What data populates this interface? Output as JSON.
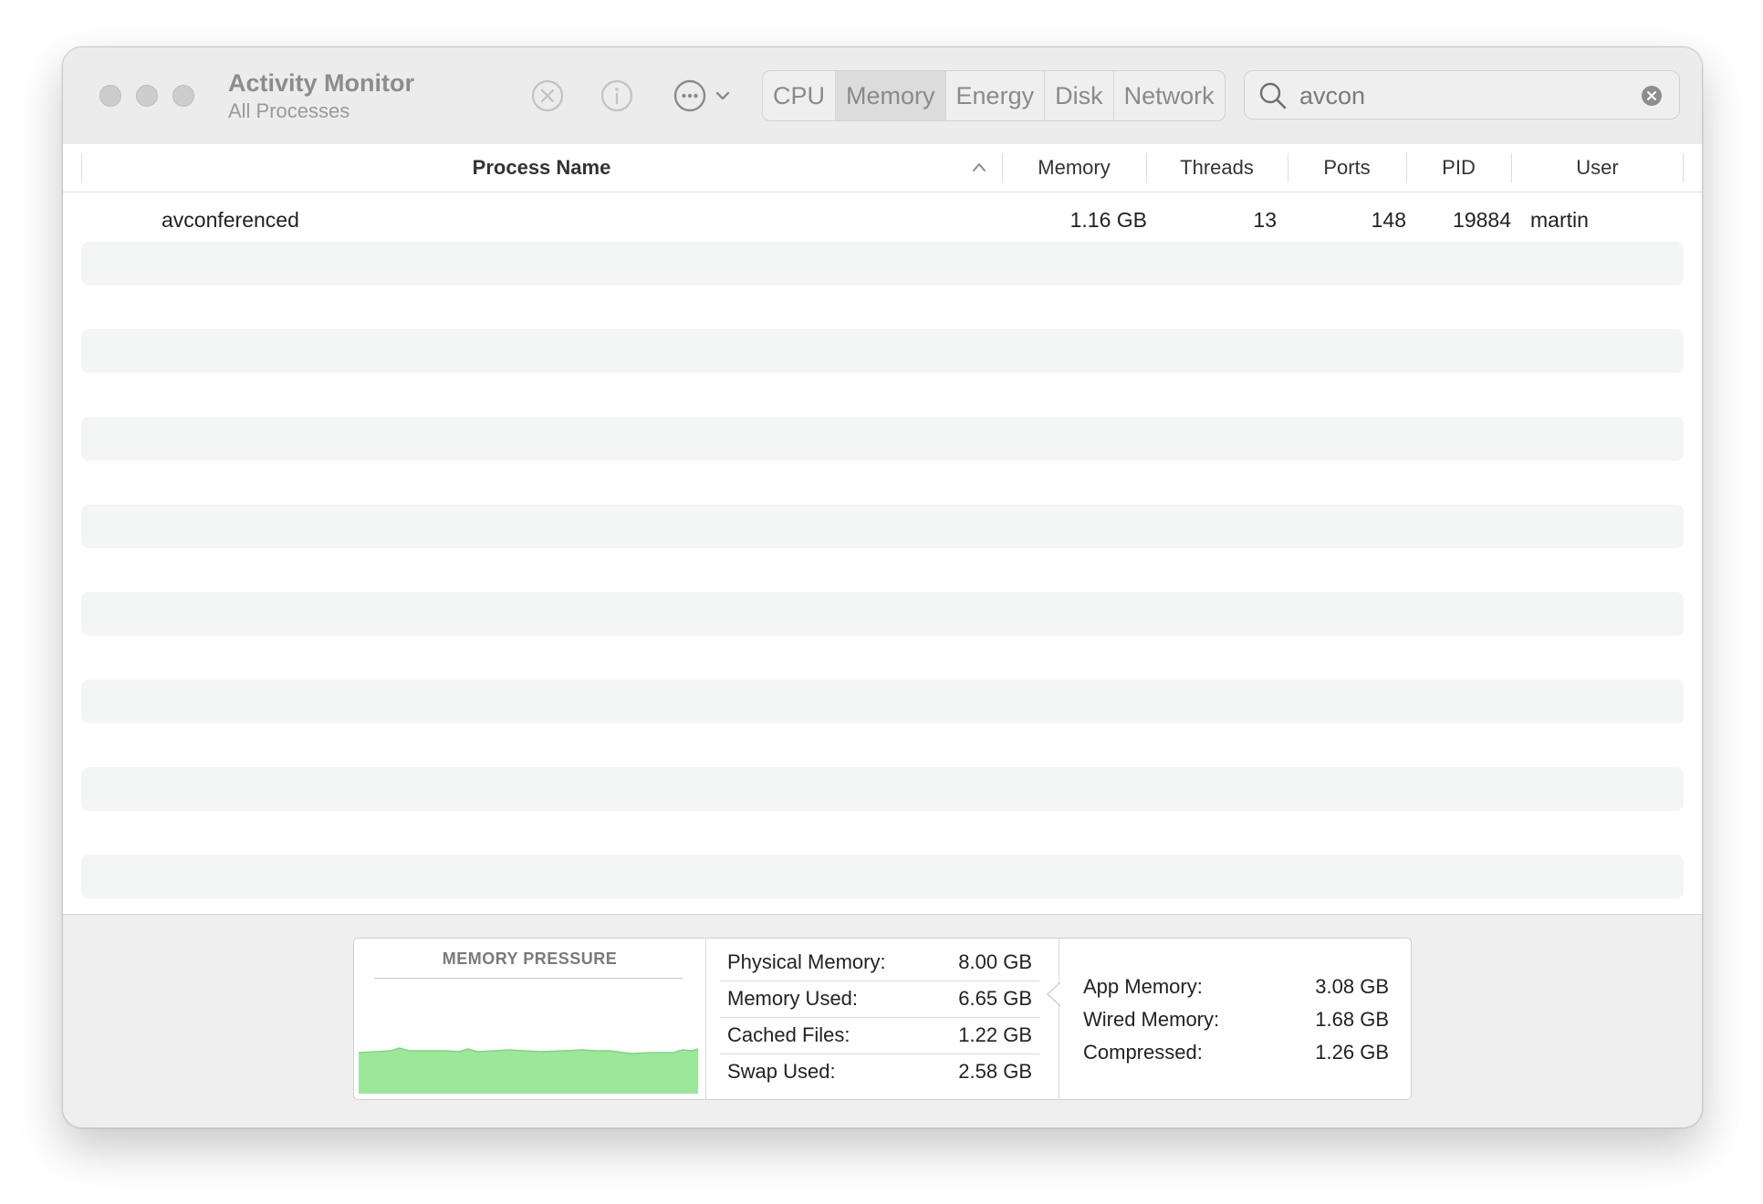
{
  "window": {
    "title": "Activity Monitor",
    "subtitle": "All Processes"
  },
  "toolbar": {
    "stop_icon": "x-circle-icon",
    "info_icon": "info-circle-icon",
    "more_icon": "ellipsis-circle-icon"
  },
  "tabs": [
    {
      "label": "CPU",
      "active": false
    },
    {
      "label": "Memory",
      "active": true
    },
    {
      "label": "Energy",
      "active": false
    },
    {
      "label": "Disk",
      "active": false
    },
    {
      "label": "Network",
      "active": false
    }
  ],
  "search": {
    "value": "avcon"
  },
  "table": {
    "headers": {
      "process_name": "Process Name",
      "memory": "Memory",
      "threads": "Threads",
      "ports": "Ports",
      "pid": "PID",
      "user": "User"
    },
    "sorted_column": "Process Name",
    "sort_direction": "ascending",
    "rows": [
      {
        "name": "avconferenced",
        "memory": "1.16 GB",
        "threads": "13",
        "ports": "148",
        "pid": "19884",
        "user": "martin"
      }
    ]
  },
  "memory_pressure": {
    "title": "MEMORY PRESSURE",
    "color": "#9be89a",
    "level": 0.33
  },
  "stats": [
    {
      "label": "Physical Memory:",
      "value": "8.00 GB"
    },
    {
      "label": "Memory Used:",
      "value": "6.65 GB"
    },
    {
      "label": "Cached Files:",
      "value": "1.22 GB"
    },
    {
      "label": "Swap Used:",
      "value": "2.58 GB"
    }
  ],
  "breakdown": [
    {
      "label": "App Memory:",
      "value": "3.08 GB"
    },
    {
      "label": "Wired Memory:",
      "value": "1.68 GB"
    },
    {
      "label": "Compressed:",
      "value": "1.26 GB"
    }
  ]
}
